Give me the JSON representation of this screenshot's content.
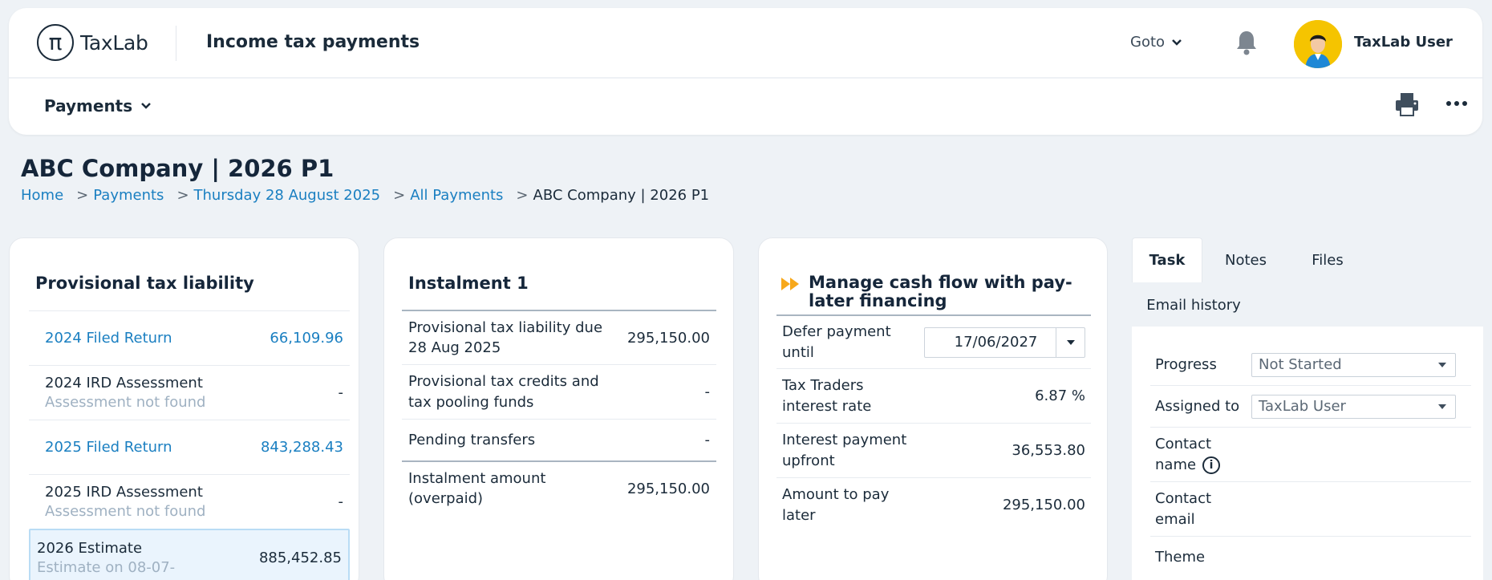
{
  "app": {
    "logo_text": "TaxLab",
    "title": "Income tax payments",
    "goto_label": "Goto",
    "user_name": "TaxLab User"
  },
  "subnav": {
    "payments_label": "Payments"
  },
  "page": {
    "title": "ABC Company | 2026 P1",
    "breadcrumb": [
      "Home",
      "Payments",
      "Thursday 28 August 2025",
      "All Payments",
      "ABC Company | 2026 P1"
    ],
    "breadcrumb_sep": ">"
  },
  "liability": {
    "title": "Provisional tax liability",
    "rows": [
      {
        "label": "2024 Filed Return",
        "sub": "",
        "value": "66,109.96"
      },
      {
        "label": "2024 IRD Assessment",
        "sub": "Assessment not found",
        "value": "-"
      },
      {
        "label": "2025 Filed Return",
        "sub": "",
        "value": "843,288.43"
      },
      {
        "label": "2025 IRD Assessment",
        "sub": "Assessment not found",
        "value": "-"
      },
      {
        "label": "2026 Estimate",
        "sub": "Estimate on 08-07-",
        "value": "885,452.85"
      }
    ]
  },
  "instalment": {
    "title": "Instalment 1",
    "rows": [
      {
        "label": "Provisional tax liability due 28 Aug 2025",
        "value": "295,150.00"
      },
      {
        "label": "Provisional tax credits and tax pooling funds",
        "value": "-"
      },
      {
        "label": "Pending transfers",
        "value": "-"
      },
      {
        "label": "Instalment amount (overpaid)",
        "value": "295,150.00"
      }
    ]
  },
  "cashflow": {
    "title": "Manage cash flow with pay-later financing",
    "defer_label": "Defer payment until",
    "defer_date": "17/06/2027",
    "rows": [
      {
        "label": "Tax Traders interest rate",
        "value": "6.87 %"
      },
      {
        "label": "Interest payment upfront",
        "value": "36,553.80"
      },
      {
        "label": "Amount to pay later",
        "value": "295,150.00"
      }
    ]
  },
  "tabs": {
    "items": [
      "Task",
      "Notes",
      "Files",
      "Email history"
    ],
    "active": "Task"
  },
  "task": {
    "progress_label": "Progress",
    "progress_value": "Not Started",
    "assigned_label": "Assigned to",
    "assigned_value": "TaxLab User",
    "contact_name_label": "Contact name",
    "contact_email_label": "Contact email",
    "theme_label": "Theme"
  },
  "colors": {
    "link": "#1a7fc1",
    "brand_yellow": "#f5c400",
    "accent_orange": "#f7a81b",
    "text_dark": "#15263a"
  }
}
